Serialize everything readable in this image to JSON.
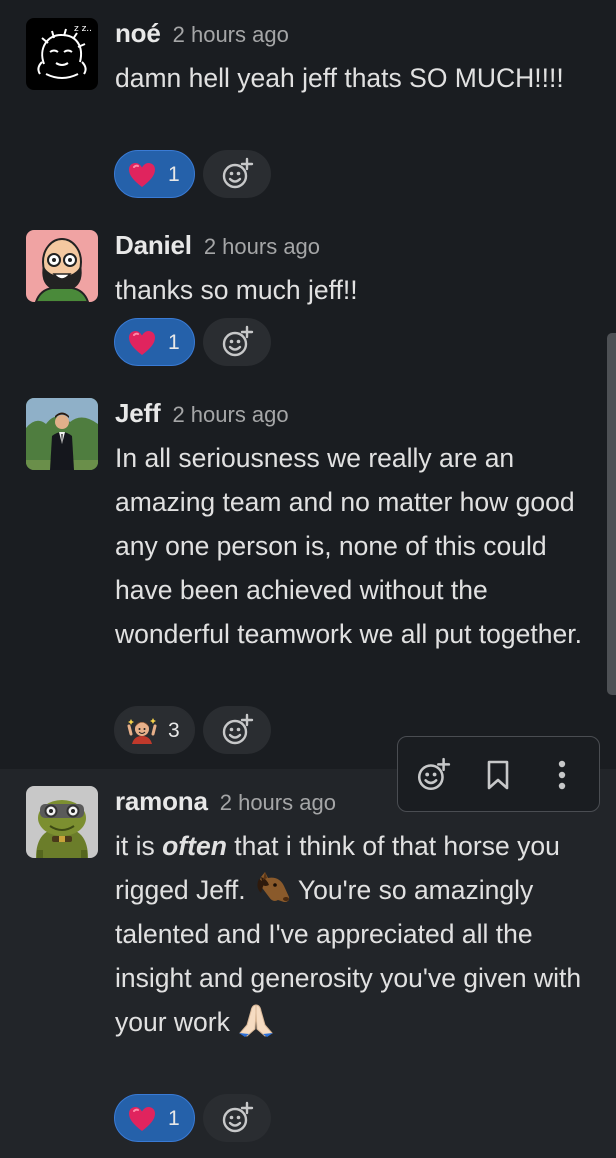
{
  "messages": [
    {
      "author": "noé",
      "time": "2 hours ago",
      "text": "damn hell yeah jeff thats SO MUCH!!!!",
      "reaction": {
        "emoji": "heart-emoji",
        "count": "1"
      }
    },
    {
      "author": "Daniel",
      "time": "2 hours ago",
      "text": "thanks so much jeff!!",
      "reaction": {
        "emoji": "heart-emoji",
        "count": "1"
      }
    },
    {
      "author": "Jeff",
      "time": "2 hours ago",
      "text": "In all seriousness we really are an amazing team and no matter how good any one person is, none of this could have been achieved without the wonderful teamwork we all put together.",
      "reaction": {
        "emoji": "custom-celebrate-emoji",
        "count": "3"
      }
    },
    {
      "author": "ramona",
      "time": "2 hours ago",
      "text_part1": "it is ",
      "text_emphasis": "often",
      "text_part2": " that i think of that horse you rigged Jeff. ",
      "text_part3": " You're so amazingly talented and I've appreciated all the insight and generosity you've given with your work ",
      "inline_emojis": [
        "horse-face-emoji",
        "folded-hands-emoji"
      ],
      "reaction": {
        "emoji": "heart-emoji",
        "count": "1"
      }
    }
  ],
  "hover_toolbar": {
    "icons": [
      "add-reaction-icon",
      "bookmark-icon",
      "more-actions-icon"
    ]
  },
  "colors": {
    "background": "#1a1d21",
    "hover_background": "#222529",
    "reaction_selected": "#2561aa",
    "reaction_selected_border": "#3a7bd5",
    "reaction_neutral": "#2a2d31",
    "author": "#e8e8e8",
    "timestamp": "#a5a6a7",
    "heart": "#e0245e"
  }
}
